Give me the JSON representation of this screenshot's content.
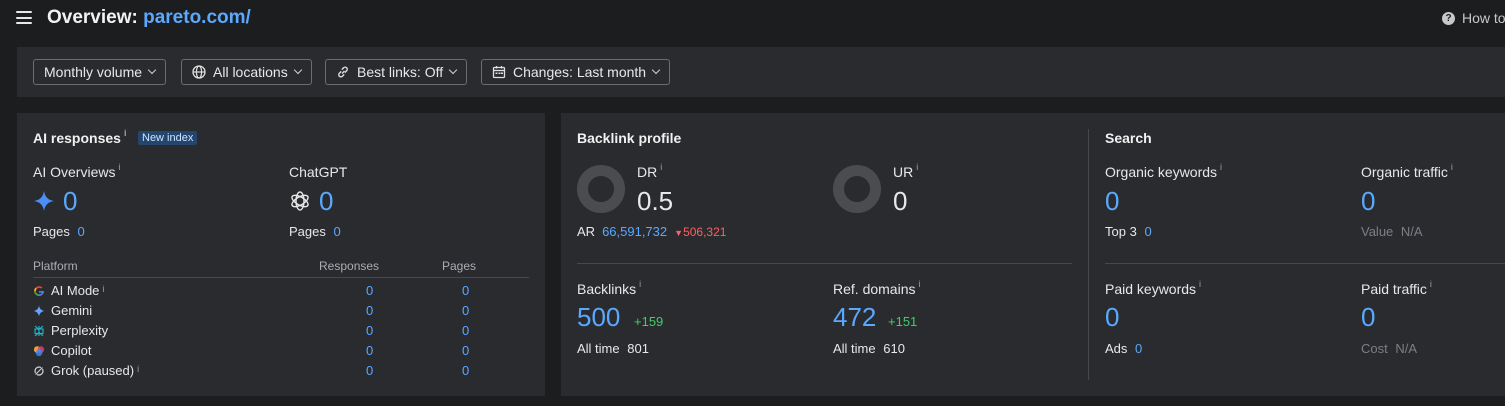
{
  "header": {
    "title_prefix": "Overview:",
    "title_url": "pareto.com/",
    "help": "How to"
  },
  "filters": [
    {
      "label": "Monthly volume",
      "icon": "none"
    },
    {
      "label": "All locations",
      "icon": "globe-icon"
    },
    {
      "label": "Best links: Off",
      "icon": "link-icon"
    },
    {
      "label": "Changes: Last month",
      "icon": "calendar-icon"
    }
  ],
  "ai": {
    "title": "AI responses",
    "info": "i",
    "badge": "New index",
    "overviews": {
      "label": "AI Overviews",
      "info": "i",
      "value": "0",
      "pages_label": "Pages",
      "pages_value": "0"
    },
    "chatgpt": {
      "label": "ChatGPT",
      "value": "0",
      "pages_label": "Pages",
      "pages_value": "0"
    },
    "table": {
      "headers": [
        "Platform",
        "Responses",
        "Pages"
      ],
      "rows": [
        {
          "name": "AI Mode",
          "info": "i",
          "responses": "0",
          "pages": "0",
          "icon": "google-icon"
        },
        {
          "name": "Gemini",
          "info": "",
          "responses": "0",
          "pages": "0",
          "icon": "gemini-icon"
        },
        {
          "name": "Perplexity",
          "info": "",
          "responses": "0",
          "pages": "0",
          "icon": "perplexity-icon"
        },
        {
          "name": "Copilot",
          "info": "",
          "responses": "0",
          "pages": "0",
          "icon": "copilot-icon"
        },
        {
          "name": "Grok (paused)",
          "info": "i",
          "responses": "0",
          "pages": "0",
          "icon": "grok-icon"
        }
      ]
    }
  },
  "backlink": {
    "title": "Backlink profile",
    "dr": {
      "label": "DR",
      "info": "i",
      "value": "0.5"
    },
    "ur": {
      "label": "UR",
      "info": "i",
      "value": "0"
    },
    "ar": {
      "label": "AR",
      "value": "66,591,732",
      "change": "506,321"
    },
    "backlinks": {
      "label": "Backlinks",
      "info": "i",
      "value": "500",
      "change": "+159",
      "alltime_label": "All time",
      "alltime_value": "801"
    },
    "refdomains": {
      "label": "Ref. domains",
      "info": "i",
      "value": "472",
      "change": "+151",
      "alltime_label": "All time",
      "alltime_value": "610"
    }
  },
  "search": {
    "title": "Search",
    "organic_keywords": {
      "label": "Organic keywords",
      "info": "i",
      "value": "0",
      "sub_label": "Top 3",
      "sub_value": "0"
    },
    "organic_traffic": {
      "label": "Organic traffic",
      "info": "i",
      "value": "0",
      "sub_label": "Value",
      "sub_value": "N/A"
    },
    "paid_keywords": {
      "label": "Paid keywords",
      "info": "i",
      "value": "0",
      "sub_label": "Ads",
      "sub_value": "0"
    },
    "paid_traffic": {
      "label": "Paid traffic",
      "info": "i",
      "value": "0",
      "sub_label": "Cost",
      "sub_value": "N/A"
    }
  },
  "colors": {
    "accent": "#5aa9ff",
    "positive": "#3ecf6a",
    "negative": "#ff5f5f",
    "panel": "#2a2b2e",
    "background": "#1c1d1f"
  }
}
